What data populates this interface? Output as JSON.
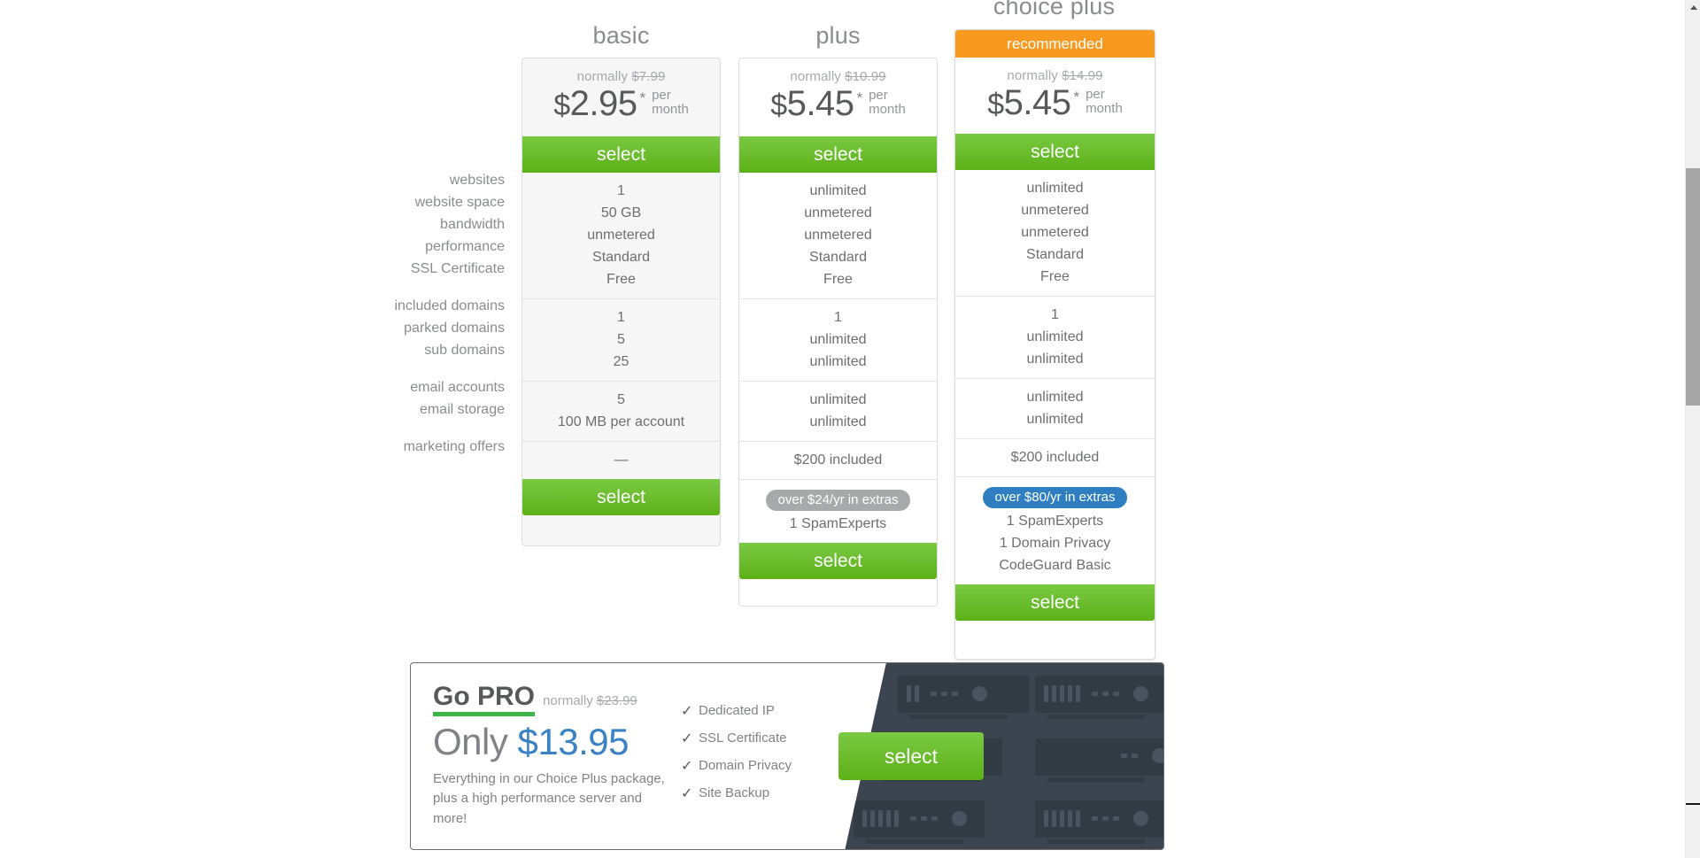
{
  "plans": [
    {
      "id": "basic",
      "name": "basic",
      "recommended_label": null,
      "normally_prefix": "normally",
      "normally_price": "$7.99",
      "currency": "$",
      "price": "2.95",
      "asterisk": "*",
      "per_line1": "per",
      "per_line2": "month",
      "select_label": "select",
      "select_label_bottom": "select",
      "groups": [
        [
          "1",
          "50 GB",
          "unmetered",
          "Standard",
          "Free"
        ],
        [
          "1",
          "5",
          "25"
        ],
        [
          "5",
          "100 MB per account"
        ],
        [
          "—"
        ]
      ],
      "badge": null,
      "extras": []
    },
    {
      "id": "plus",
      "name": "plus",
      "recommended_label": null,
      "normally_prefix": "normally",
      "normally_price": "$10.99",
      "currency": "$",
      "price": "5.45",
      "asterisk": "*",
      "per_line1": "per",
      "per_line2": "month",
      "select_label": "select",
      "select_label_bottom": "select",
      "groups": [
        [
          "unlimited",
          "unmetered",
          "unmetered",
          "Standard",
          "Free"
        ],
        [
          "1",
          "unlimited",
          "unlimited"
        ],
        [
          "unlimited",
          "unlimited"
        ],
        [
          "$200 included"
        ]
      ],
      "badge": {
        "text": "over $24/yr in extras",
        "color": "#a8a9ab",
        "style": "gray"
      },
      "extras": [
        "1 SpamExperts"
      ]
    },
    {
      "id": "choiceplus",
      "name": "choice plus",
      "recommended_label": "recommended",
      "normally_prefix": "normally",
      "normally_price": "$14.99",
      "currency": "$",
      "price": "5.45",
      "asterisk": "*",
      "per_line1": "per",
      "per_line2": "month",
      "select_label": "select",
      "select_label_bottom": "select",
      "groups": [
        [
          "unlimited",
          "unmetered",
          "unmetered",
          "Standard",
          "Free"
        ],
        [
          "1",
          "unlimited",
          "unlimited"
        ],
        [
          "unlimited",
          "unlimited"
        ],
        [
          "$200 included"
        ]
      ],
      "badge": {
        "text": "over $80/yr in extras",
        "color": "#2e7ec1",
        "style": "blue"
      },
      "extras": [
        "1 SpamExperts",
        "1 Domain Privacy",
        "CodeGuard Basic"
      ]
    }
  ],
  "feature_label_groups": [
    [
      "websites",
      "website space",
      "bandwidth",
      "performance",
      "SSL Certificate"
    ],
    [
      "included domains",
      "parked domains",
      "sub domains"
    ],
    [
      "email accounts",
      "email storage"
    ],
    [
      "marketing offers"
    ]
  ],
  "gopro": {
    "title": "Go PRO",
    "normally_prefix": "normally",
    "normally_price": "$23.99",
    "price_prefix": "Only",
    "price": "$13.95",
    "description": "Everything in our Choice Plus package, plus a high performance server and more!",
    "features": [
      "Dedicated IP",
      "SSL Certificate",
      "Domain Privacy",
      "Site Backup"
    ],
    "check_glyph": "✓",
    "select_label": "select"
  },
  "colors": {
    "green": "#6cbe2a",
    "orange": "#f79a1f",
    "blue": "#2e7ec1",
    "gray_badge": "#a8a9ab",
    "price_blue": "#3b82c4",
    "dark_panel": "#3b444f"
  }
}
